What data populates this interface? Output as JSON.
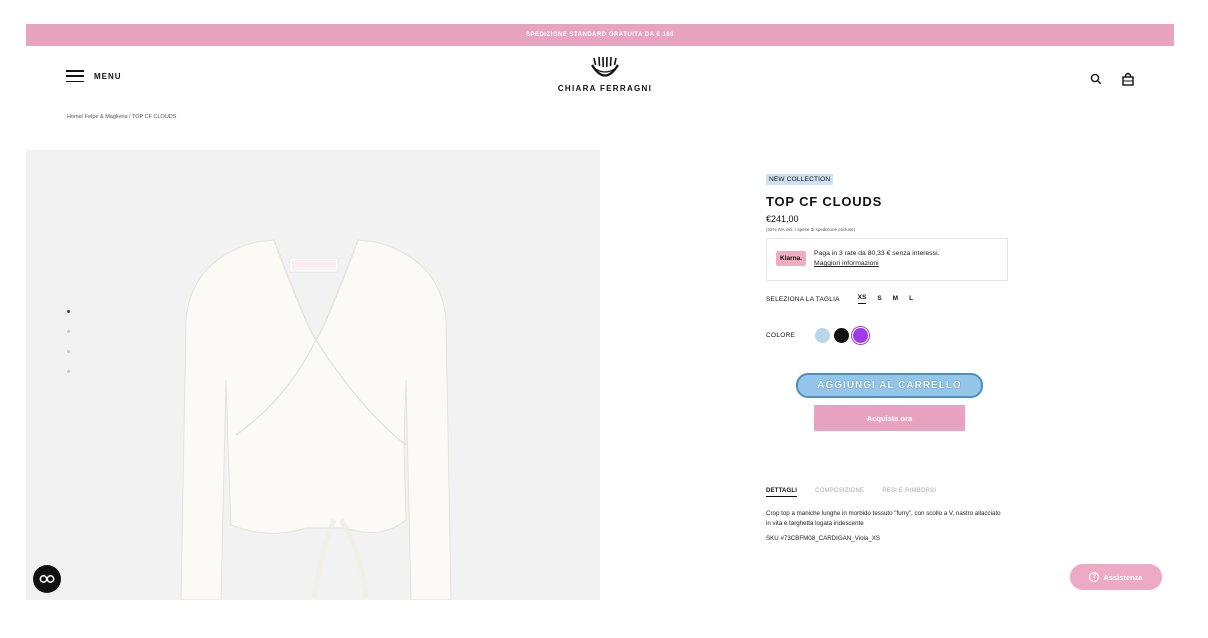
{
  "promo": {
    "text": "SPEDIZIONE STANDARD GRATUITA DA € 160"
  },
  "header": {
    "menu_label": "MENU",
    "logo_text": "CHIARA FERRAGNI",
    "icons": [
      "search-icon",
      "shopping-bag-icon"
    ]
  },
  "breadcrumb": "Home/ Felpe & Maglieria / TOP CF CLOUDS",
  "gallery": {
    "dot_count": 4,
    "active_dot": 1
  },
  "product": {
    "badge": "NEW COLLECTION",
    "title": "TOP CF CLOUDS",
    "price": "€241,00",
    "price_note": "(22% IVA incl. / spese di spedizione escluse)",
    "klarna": {
      "logo": "Klarna.",
      "text": "Paga in 3 rate da 80,33 € senza interessi.",
      "link": "Maggiori informazioni"
    },
    "size": {
      "label": "SELEZIONA LA TAGLIA",
      "options": [
        "XS",
        "S",
        "M",
        "L"
      ],
      "selected": "XS"
    },
    "color": {
      "label": "COLORE",
      "swatches": [
        "#b9d6ea",
        "#111111",
        "#9b3be8"
      ],
      "selected": "#9b3be8"
    },
    "add_to_cart": "AGGIUNGI AL CARRELLO",
    "buy_now": "Acquista ora"
  },
  "tabs": {
    "items": [
      "DETTAGLI",
      "COMPOSIZIONE",
      "RESI E RIMBORSI"
    ],
    "active": "DETTAGLI",
    "description": "Crop top a maniche lunghe in morbido tessuto \"furry\", con scollo a V, nastro allacciato in vita e targhetta logata iridescente",
    "sku": "SKU #73CBFM08_CARDIGAN_Viola_XS"
  },
  "assist": {
    "label": "Assistenza"
  },
  "colors": {
    "promo_pink": "#e7a3bf",
    "button_blue": "#93c6e8",
    "badge_blue": "#cfe0ef"
  }
}
